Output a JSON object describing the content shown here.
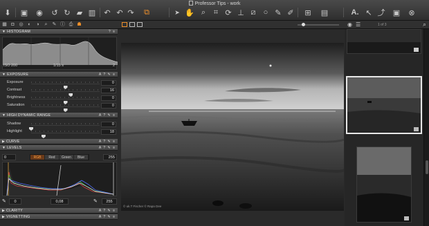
{
  "window": {
    "title": "Professor Tips - work"
  },
  "toolbar": {
    "left_icons": [
      "import-icon",
      "capture-icon",
      "camera-icon",
      "rotate-left-icon",
      "rotate-right-icon",
      "folder-icon",
      "trash-icon",
      "undo-icon",
      "undo-2-icon",
      "redo-icon",
      "stack-icon"
    ],
    "center_icons": [
      "pointer-icon",
      "hand-icon",
      "zoom-icon",
      "crop-icon",
      "rotate-tool-icon",
      "straighten-icon",
      "keystone-icon",
      "spot-icon",
      "circle-icon",
      "brush-icon",
      "eraser-icon",
      "picker-icon"
    ],
    "right_icons": [
      "grid-icon",
      "overlay-icon",
      "text-icon",
      "cursor-icon",
      "export-icon",
      "camera-small-icon",
      "close-circle-icon"
    ]
  },
  "tool_tabs": [
    "library-icon",
    "camera-tab-icon",
    "lens-icon",
    "color-icon",
    "exposure-icon",
    "detail-icon",
    "local-icon",
    "meta-icon",
    "output-icon",
    "batch-icon"
  ],
  "sections": {
    "histogram": {
      "title": "HISTOGRAM",
      "iso": "ISO 200",
      "shutter": "1/15 s",
      "aperture": "2"
    },
    "exposure": {
      "title": "EXPOSURE",
      "rows": [
        {
          "label": "Exposure",
          "value": "0",
          "pos": 0.5
        },
        {
          "label": "Contrast",
          "value": "16",
          "pos": 0.58
        },
        {
          "label": "Brightness",
          "value": "0",
          "pos": 0.5
        },
        {
          "label": "Saturation",
          "value": "0",
          "pos": 0.5
        }
      ]
    },
    "hdr": {
      "title": "HIGH DYNAMIC RANGE",
      "rows": [
        {
          "label": "Shadow",
          "value": "0",
          "pos": 0.0
        },
        {
          "label": "Highlight",
          "value": "18",
          "pos": 0.18
        }
      ]
    },
    "curve": {
      "title": "CURVE"
    },
    "levels": {
      "title": "LEVELS",
      "input_low": "0",
      "input_high": "255",
      "channels": [
        "RGB",
        "Red",
        "Green",
        "Blue"
      ],
      "selected_channel": "RGB",
      "output_low": "0",
      "midtone": "0,08",
      "output_high": "255"
    },
    "clarity": {
      "title": "CLARITY"
    },
    "vignetting": {
      "title": "VIGNETTING"
    }
  },
  "viewer": {
    "watermark": "© uk.T Fischer © Rapa Dee"
  },
  "browser": {
    "counter": "1 of 3"
  },
  "colors": {
    "accent": "#f0902a",
    "panel": "#2a2a2a",
    "header": "#4f4f4f"
  }
}
